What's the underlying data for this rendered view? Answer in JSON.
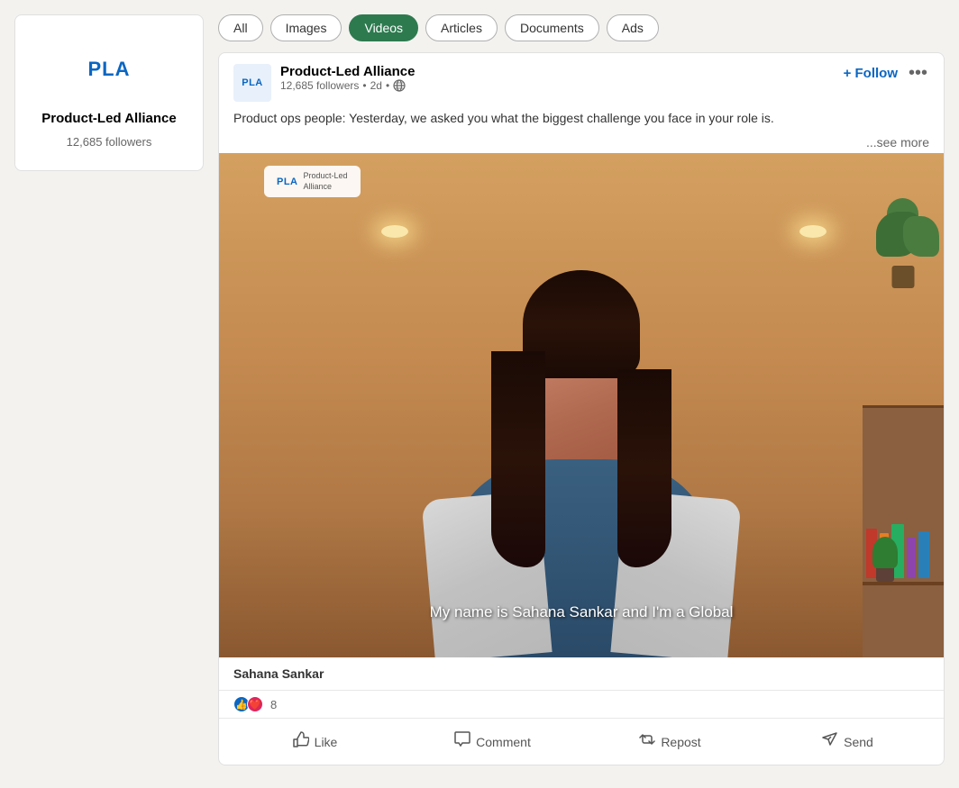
{
  "sidebar": {
    "company": {
      "name": "Product-Led Alliance",
      "followers": "12,685 followers",
      "logo_text": "PLA"
    }
  },
  "filters": {
    "tabs": [
      {
        "label": "All",
        "active": false
      },
      {
        "label": "Images",
        "active": false
      },
      {
        "label": "Videos",
        "active": true
      },
      {
        "label": "Articles",
        "active": false
      },
      {
        "label": "Documents",
        "active": false
      },
      {
        "label": "Ads",
        "active": false
      }
    ]
  },
  "post": {
    "author": "Product-Led Alliance",
    "followers": "12,685 followers",
    "time": "2d",
    "follow_label": "+ Follow",
    "more_label": "•••",
    "text": "Product ops people: Yesterday, we asked you what the biggest challenge you face in your role is.",
    "see_more": "...see more",
    "video_subtitle": "My name is Sahana Sankar and I'm a Global",
    "video_credit": "Sahana Sankar",
    "reactions_count": "8",
    "watermark_logo": "PLA",
    "watermark_text": "Product-Led\nAlliance",
    "actions": [
      {
        "label": "Like",
        "icon": "👍"
      },
      {
        "label": "Comment",
        "icon": "💬"
      },
      {
        "label": "Repost",
        "icon": "🔁"
      },
      {
        "label": "Send",
        "icon": "✉"
      }
    ]
  }
}
